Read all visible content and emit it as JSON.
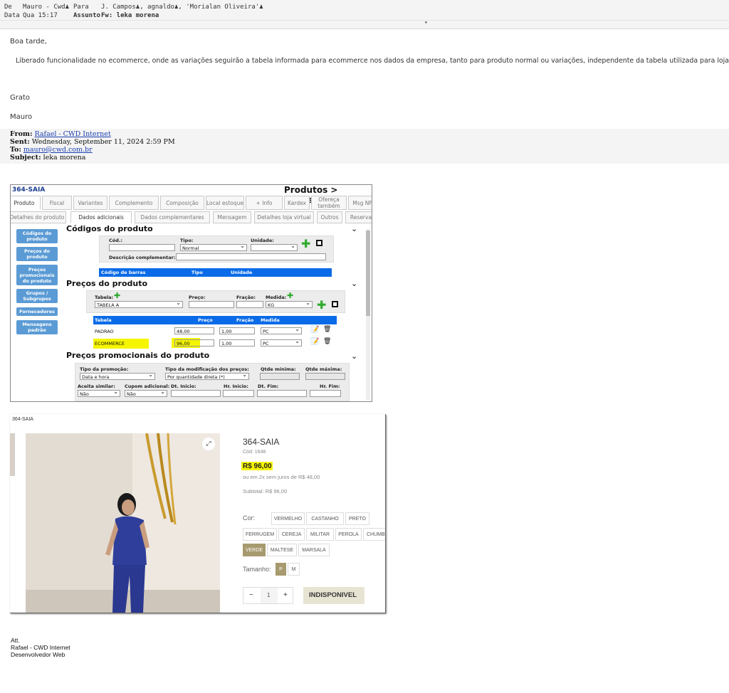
{
  "header": {
    "de_label": "De",
    "de_value": "Mauro - Cwd",
    "para_label": "Para",
    "para_value_1": "J. Campos",
    "para_value_2": ", agnaldo",
    "para_value_3": ", 'Morialan Oliveira'",
    "data_label": "Data",
    "data_value": "Qua 15:17",
    "assunto_label": "Assunto",
    "assunto_value": "Fw: leka morena"
  },
  "body": {
    "greeting": "Boa tarde,",
    "message": "Liberado funcionalidade no ecommerce, onde as variações seguirão a tabela informada para ecommerce nos dados da empresa, tanto para  produto normal ou variações, independente da tabela utilizada para loja física.",
    "thanks": "Grato",
    "sender": "Mauro"
  },
  "forwarded": {
    "from_label": "From:",
    "from_value": "Rafael - CWD Internet",
    "sent_label": "Sent:",
    "sent_value": "Wednesday, September 11, 2024 2:59 PM",
    "to_label": "To:",
    "to_value": "mauro@cwd.com.br",
    "subject_label": "Subject:",
    "subject_value": "leka morena"
  },
  "erp": {
    "product_code": "364-SAIA",
    "breadcrumb": "Produtos > Cadastro",
    "tabs_row1": [
      "Produto",
      "Fiscal",
      "Variantes",
      "Complemento",
      "Composição",
      "Local estoque",
      "+ Info",
      "Kardex",
      "Ofereça também",
      "Msg NF"
    ],
    "tabs_row2": [
      "Detalhes do produto",
      "Dados adicionais",
      "Dados complementares",
      "Mensagem",
      "Detalhes loja virtual",
      "Outros",
      "Reserva"
    ],
    "sidebar": [
      "Códigos do produto",
      "Preços do produto",
      "Preços promocionais do produto",
      "Grupos / Subgrupos",
      "Fornecedores",
      "Mensagens padrão"
    ],
    "codes": {
      "title": "Códigos do produto",
      "cod_label": "Cód.:",
      "tipo_label": "Tipo:",
      "tipo_value": "Normal",
      "unidade_label": "Unidade:",
      "desc_label": "Descrição complementar:",
      "table_headers": [
        "Código de barras",
        "Tipo",
        "Unidade"
      ]
    },
    "prices": {
      "title": "Preços do produto",
      "tabela_label": "Tabela:",
      "tabela_value": "TABELA A",
      "preco_label": "Preço:",
      "fracao_label": "Fração:",
      "medida_label": "Medida:",
      "medida_value": "KG",
      "table_headers": [
        "Tabela",
        "Preço",
        "Fração",
        "Medida"
      ],
      "rows": [
        {
          "tabela": "PADRAO",
          "preco": "48,00",
          "fracao": "1,00",
          "medida": "PC"
        },
        {
          "tabela": "ECOMMERCE",
          "preco": "96,00",
          "fracao": "1,00",
          "medida": "PC"
        }
      ]
    },
    "promo": {
      "title": "Preços promocionais do produto",
      "tipo_promo_label": "Tipo da promoção:",
      "tipo_promo_value": "Data e hora",
      "tipo_mod_label": "Tipo da modificação dos preços:",
      "tipo_mod_value": "Por quantidade direta (*)",
      "qtde_min_label": "Qtde mínima:",
      "qtde_max_label": "Qtde máxima:",
      "aceita_label": "Aceita similar:",
      "aceita_value": "Não",
      "cupom_label": "Cupom adicional:",
      "cupom_value": "Não",
      "dt_inicio_label": "Dt. Inicio:",
      "hr_inicio_label": "Hr. Inicio:",
      "dt_fim_label": "Dt. Fim:",
      "hr_fim_label": "Hr. Fim:"
    }
  },
  "shop": {
    "code": "364-SAIA",
    "product_name": "364-SAIA",
    "cod": "Cód: 1648",
    "price": "R$ 96,00",
    "installments": "ou em 2x sem juros de R$ 48,00",
    "subtotal": "Subtotal: R$ 96,00",
    "cor_label": "Cor:",
    "colors": [
      "VERMELHO",
      "CASTANHO",
      "PRETO",
      "FERRUGEM",
      "CEREJA",
      "MILITAR",
      "PEROLA",
      "CHUMBO",
      "VERDE",
      "MALTESE",
      "MARSALA"
    ],
    "selected_color": "VERDE",
    "tamanho_label": "Tamanho:",
    "sizes": [
      "P",
      "M"
    ],
    "selected_size": "P",
    "qty_minus": "−",
    "qty_value": "1",
    "qty_plus": "+",
    "unavailable_label": "INDISPONIVEL"
  },
  "signature": {
    "line1": "Att.",
    "line2": "Rafael - CWD Internet",
    "line3": "Desenvolvedor Web"
  }
}
